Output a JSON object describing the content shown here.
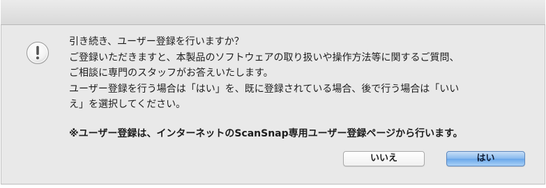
{
  "dialog": {
    "icon": "alert-icon",
    "message_lines": [
      "引き続き、ユーザー登録を行いますか？",
      "ご登録いただきますと、本製品のソフトウェアの取り扱いや操作方法等に関するご質問、",
      "ご相談に専門のスタッフがお答えいたします。",
      "ユーザー登録を行う場合は「はい」を、既に登録されている場合、後で行う場合は「いい",
      "え」を選択してください。"
    ],
    "note": "※ユーザー登録は、インターネットのScanSnap専用ユーザー登録ページから行います。",
    "buttons": {
      "no_label": "いいえ",
      "yes_label": "はい"
    }
  },
  "colors": {
    "dialog_background": "#e9e9e9",
    "default_button": "#86b8ee"
  }
}
